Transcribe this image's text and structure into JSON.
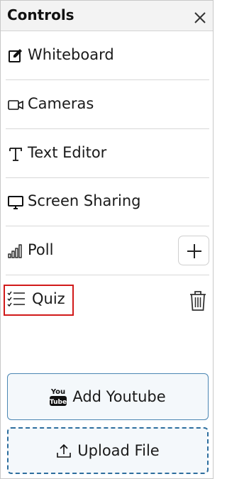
{
  "header": {
    "title": "Controls"
  },
  "items": [
    {
      "label": "Whiteboard",
      "icon": "edit-icon"
    },
    {
      "label": "Cameras",
      "icon": "camera-icon"
    },
    {
      "label": "Text Editor",
      "icon": "text-icon"
    },
    {
      "label": "Screen Sharing",
      "icon": "monitor-icon"
    },
    {
      "label": "Poll",
      "icon": "poll-icon"
    },
    {
      "label": "Quiz",
      "icon": "checklist-icon"
    }
  ],
  "buttons": {
    "youtube": {
      "label": "Add Youtube",
      "icon_text_top": "You",
      "icon_text_bottom": "Tube"
    },
    "upload": {
      "label": "Upload File"
    }
  },
  "colors": {
    "highlight": "#d11a1a",
    "button_border": "#4b86b3",
    "upload_border": "#2d6e9e"
  }
}
